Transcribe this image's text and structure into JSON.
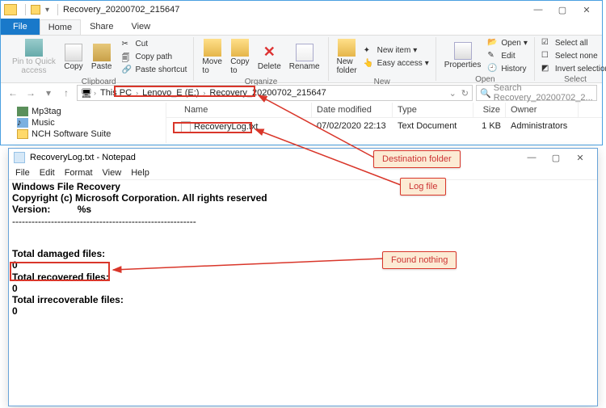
{
  "explorer": {
    "title": "Recovery_20200702_215647",
    "tabs": {
      "file": "File",
      "home": "Home",
      "share": "Share",
      "view": "View"
    },
    "ribbon": {
      "clipboard": {
        "label": "Clipboard",
        "pin": "Pin to Quick\naccess",
        "copy": "Copy",
        "paste": "Paste",
        "cut": "Cut",
        "copypath": "Copy path",
        "pasteshortcut": "Paste shortcut"
      },
      "organize": {
        "label": "Organize",
        "moveto": "Move\nto",
        "copyto": "Copy\nto",
        "delete": "Delete",
        "rename": "Rename"
      },
      "new": {
        "label": "New",
        "folder": "New\nfolder",
        "item": "New item",
        "easy": "Easy access"
      },
      "open": {
        "label": "Open",
        "properties": "Properties",
        "open": "Open",
        "edit": "Edit",
        "history": "History"
      },
      "select": {
        "label": "Select",
        "all": "Select all",
        "none": "Select none",
        "invert": "Invert selection"
      }
    },
    "breadcrumb": {
      "thispc": "This PC",
      "drive": "Lenovo_E (E:)",
      "folder": "Recovery_20200702_215647"
    },
    "search_placeholder": "Search Recovery_20200702_2...",
    "tree": {
      "mp3tag": "Mp3tag",
      "music": "Music",
      "nch": "NCH Software Suite"
    },
    "columns": {
      "name": "Name",
      "date": "Date modified",
      "type": "Type",
      "size": "Size",
      "owner": "Owner"
    },
    "row": {
      "name": "RecoveryLog.txt",
      "date": "07/02/2020 22:13",
      "type": "Text Document",
      "size": "1 KB",
      "owner": "Administrators"
    }
  },
  "notepad": {
    "title": "RecoveryLog.txt - Notepad",
    "menu": {
      "file": "File",
      "edit": "Edit",
      "format": "Format",
      "view": "View",
      "help": "Help"
    },
    "lines": {
      "l1": "Windows File Recovery",
      "l2": "Copyright (c) Microsoft Corporation. All rights reserved",
      "l3": "Version:          %s",
      "sep": "---------------------------------------------------------",
      "damaged_h": "Total damaged files:",
      "damaged_v": "0",
      "recovered_h": "Total recovered files:",
      "recovered_v": "0",
      "irrec_h": "Total irrecoverable files:",
      "irrec_v": "0"
    }
  },
  "callouts": {
    "dest": "Destination folder",
    "log": "Log file",
    "nothing": "Found nothing"
  }
}
